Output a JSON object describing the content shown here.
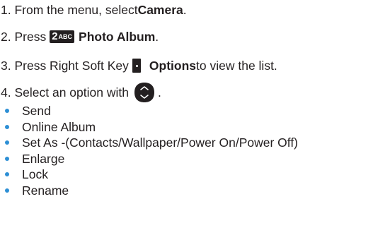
{
  "steps": {
    "s1": {
      "prefix": "1. From the menu, select ",
      "bold": "Camera",
      "suffix": "."
    },
    "s2": {
      "prefix": "2. Press ",
      "key_number": "2",
      "key_letters": "ABC",
      "bold": "Photo Album",
      "suffix": "."
    },
    "s3": {
      "prefix": "3. Press Right Soft Key ",
      "bold": "Options",
      "suffix": " to view the list."
    },
    "s4": {
      "prefix": "4. Select an option with ",
      "suffix": "."
    }
  },
  "options": [
    "Send",
    "Online Album",
    "Set As -(Contacts/Wallpaper/Power On/Power Off)",
    "Enlarge",
    "Lock",
    "Rename"
  ],
  "icons": {
    "key": "keypad-2-abc-icon",
    "softkey": "right-soft-key-icon",
    "navkey": "navigation-key-icon"
  },
  "colors": {
    "text": "#231f20",
    "bullet": "#2d8fd5"
  }
}
